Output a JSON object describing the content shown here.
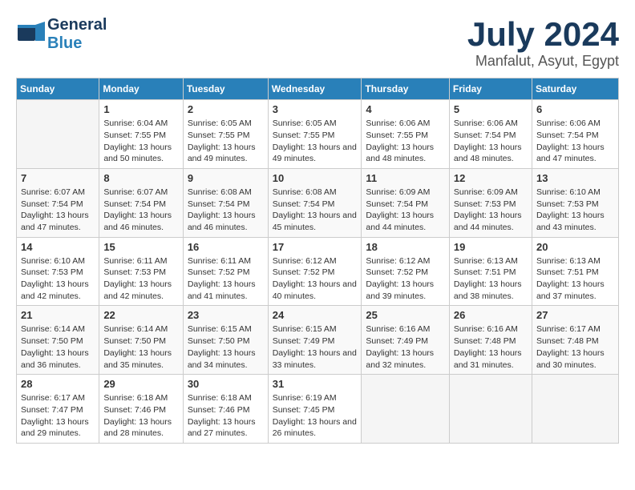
{
  "header": {
    "logo_general": "General",
    "logo_blue": "Blue",
    "title": "July 2024",
    "subtitle": "Manfalut, Asyut, Egypt"
  },
  "days_of_week": [
    "Sunday",
    "Monday",
    "Tuesday",
    "Wednesday",
    "Thursday",
    "Friday",
    "Saturday"
  ],
  "weeks": [
    [
      {
        "num": "",
        "sunrise": "",
        "sunset": "",
        "daylight": ""
      },
      {
        "num": "1",
        "sunrise": "Sunrise: 6:04 AM",
        "sunset": "Sunset: 7:55 PM",
        "daylight": "Daylight: 13 hours and 50 minutes."
      },
      {
        "num": "2",
        "sunrise": "Sunrise: 6:05 AM",
        "sunset": "Sunset: 7:55 PM",
        "daylight": "Daylight: 13 hours and 49 minutes."
      },
      {
        "num": "3",
        "sunrise": "Sunrise: 6:05 AM",
        "sunset": "Sunset: 7:55 PM",
        "daylight": "Daylight: 13 hours and 49 minutes."
      },
      {
        "num": "4",
        "sunrise": "Sunrise: 6:06 AM",
        "sunset": "Sunset: 7:55 PM",
        "daylight": "Daylight: 13 hours and 48 minutes."
      },
      {
        "num": "5",
        "sunrise": "Sunrise: 6:06 AM",
        "sunset": "Sunset: 7:54 PM",
        "daylight": "Daylight: 13 hours and 48 minutes."
      },
      {
        "num": "6",
        "sunrise": "Sunrise: 6:06 AM",
        "sunset": "Sunset: 7:54 PM",
        "daylight": "Daylight: 13 hours and 47 minutes."
      }
    ],
    [
      {
        "num": "7",
        "sunrise": "Sunrise: 6:07 AM",
        "sunset": "Sunset: 7:54 PM",
        "daylight": "Daylight: 13 hours and 47 minutes."
      },
      {
        "num": "8",
        "sunrise": "Sunrise: 6:07 AM",
        "sunset": "Sunset: 7:54 PM",
        "daylight": "Daylight: 13 hours and 46 minutes."
      },
      {
        "num": "9",
        "sunrise": "Sunrise: 6:08 AM",
        "sunset": "Sunset: 7:54 PM",
        "daylight": "Daylight: 13 hours and 46 minutes."
      },
      {
        "num": "10",
        "sunrise": "Sunrise: 6:08 AM",
        "sunset": "Sunset: 7:54 PM",
        "daylight": "Daylight: 13 hours and 45 minutes."
      },
      {
        "num": "11",
        "sunrise": "Sunrise: 6:09 AM",
        "sunset": "Sunset: 7:54 PM",
        "daylight": "Daylight: 13 hours and 44 minutes."
      },
      {
        "num": "12",
        "sunrise": "Sunrise: 6:09 AM",
        "sunset": "Sunset: 7:53 PM",
        "daylight": "Daylight: 13 hours and 44 minutes."
      },
      {
        "num": "13",
        "sunrise": "Sunrise: 6:10 AM",
        "sunset": "Sunset: 7:53 PM",
        "daylight": "Daylight: 13 hours and 43 minutes."
      }
    ],
    [
      {
        "num": "14",
        "sunrise": "Sunrise: 6:10 AM",
        "sunset": "Sunset: 7:53 PM",
        "daylight": "Daylight: 13 hours and 42 minutes."
      },
      {
        "num": "15",
        "sunrise": "Sunrise: 6:11 AM",
        "sunset": "Sunset: 7:53 PM",
        "daylight": "Daylight: 13 hours and 42 minutes."
      },
      {
        "num": "16",
        "sunrise": "Sunrise: 6:11 AM",
        "sunset": "Sunset: 7:52 PM",
        "daylight": "Daylight: 13 hours and 41 minutes."
      },
      {
        "num": "17",
        "sunrise": "Sunrise: 6:12 AM",
        "sunset": "Sunset: 7:52 PM",
        "daylight": "Daylight: 13 hours and 40 minutes."
      },
      {
        "num": "18",
        "sunrise": "Sunrise: 6:12 AM",
        "sunset": "Sunset: 7:52 PM",
        "daylight": "Daylight: 13 hours and 39 minutes."
      },
      {
        "num": "19",
        "sunrise": "Sunrise: 6:13 AM",
        "sunset": "Sunset: 7:51 PM",
        "daylight": "Daylight: 13 hours and 38 minutes."
      },
      {
        "num": "20",
        "sunrise": "Sunrise: 6:13 AM",
        "sunset": "Sunset: 7:51 PM",
        "daylight": "Daylight: 13 hours and 37 minutes."
      }
    ],
    [
      {
        "num": "21",
        "sunrise": "Sunrise: 6:14 AM",
        "sunset": "Sunset: 7:50 PM",
        "daylight": "Daylight: 13 hours and 36 minutes."
      },
      {
        "num": "22",
        "sunrise": "Sunrise: 6:14 AM",
        "sunset": "Sunset: 7:50 PM",
        "daylight": "Daylight: 13 hours and 35 minutes."
      },
      {
        "num": "23",
        "sunrise": "Sunrise: 6:15 AM",
        "sunset": "Sunset: 7:50 PM",
        "daylight": "Daylight: 13 hours and 34 minutes."
      },
      {
        "num": "24",
        "sunrise": "Sunrise: 6:15 AM",
        "sunset": "Sunset: 7:49 PM",
        "daylight": "Daylight: 13 hours and 33 minutes."
      },
      {
        "num": "25",
        "sunrise": "Sunrise: 6:16 AM",
        "sunset": "Sunset: 7:49 PM",
        "daylight": "Daylight: 13 hours and 32 minutes."
      },
      {
        "num": "26",
        "sunrise": "Sunrise: 6:16 AM",
        "sunset": "Sunset: 7:48 PM",
        "daylight": "Daylight: 13 hours and 31 minutes."
      },
      {
        "num": "27",
        "sunrise": "Sunrise: 6:17 AM",
        "sunset": "Sunset: 7:48 PM",
        "daylight": "Daylight: 13 hours and 30 minutes."
      }
    ],
    [
      {
        "num": "28",
        "sunrise": "Sunrise: 6:17 AM",
        "sunset": "Sunset: 7:47 PM",
        "daylight": "Daylight: 13 hours and 29 minutes."
      },
      {
        "num": "29",
        "sunrise": "Sunrise: 6:18 AM",
        "sunset": "Sunset: 7:46 PM",
        "daylight": "Daylight: 13 hours and 28 minutes."
      },
      {
        "num": "30",
        "sunrise": "Sunrise: 6:18 AM",
        "sunset": "Sunset: 7:46 PM",
        "daylight": "Daylight: 13 hours and 27 minutes."
      },
      {
        "num": "31",
        "sunrise": "Sunrise: 6:19 AM",
        "sunset": "Sunset: 7:45 PM",
        "daylight": "Daylight: 13 hours and 26 minutes."
      },
      {
        "num": "",
        "sunrise": "",
        "sunset": "",
        "daylight": ""
      },
      {
        "num": "",
        "sunrise": "",
        "sunset": "",
        "daylight": ""
      },
      {
        "num": "",
        "sunrise": "",
        "sunset": "",
        "daylight": ""
      }
    ]
  ]
}
